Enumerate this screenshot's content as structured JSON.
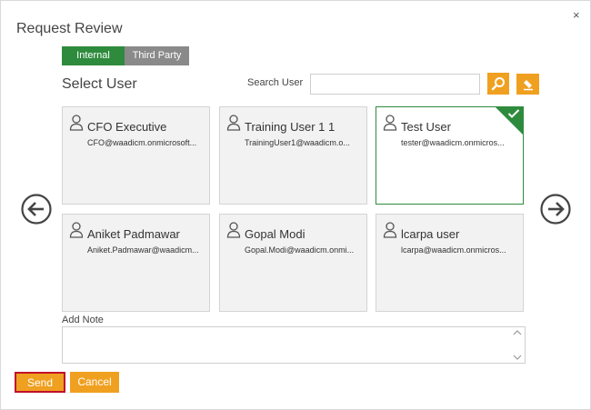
{
  "dialog": {
    "title": "Request Review",
    "close_label": "×"
  },
  "tabs": [
    {
      "label": "Internal",
      "active": true
    },
    {
      "label": "Third Party",
      "active": false
    }
  ],
  "select_user_heading": "Select User",
  "search": {
    "label": "Search User",
    "value": "",
    "placeholder": ""
  },
  "users": [
    {
      "name": "CFO Executive",
      "email": "CFO@waadicm.onmicrosoft...",
      "selected": false
    },
    {
      "name": "Training User 1 1",
      "email": "TrainingUser1@waadicm.o...",
      "selected": false
    },
    {
      "name": "Test User",
      "email": "tester@waadicm.onmicros...",
      "selected": true
    },
    {
      "name": "Aniket Padmawar",
      "email": "Aniket.Padmawar@waadicm...",
      "selected": false
    },
    {
      "name": "Gopal Modi",
      "email": "Gopal.Modi@waadicm.onmi...",
      "selected": false
    },
    {
      "name": "lcarpa user",
      "email": "lcarpa@waadicm.onmicros...",
      "selected": false
    }
  ],
  "note": {
    "label": "Add Note",
    "value": ""
  },
  "actions": {
    "send_label": "Send",
    "cancel_label": "Cancel"
  },
  "colors": {
    "accent_green": "#2e8b3d",
    "accent_orange": "#f0a020",
    "send_outline": "#c0102a"
  },
  "icons": [
    "close-icon",
    "search-icon",
    "eraser-icon",
    "user-icon",
    "checkmark-icon",
    "arrow-left-icon",
    "arrow-right-icon"
  ]
}
